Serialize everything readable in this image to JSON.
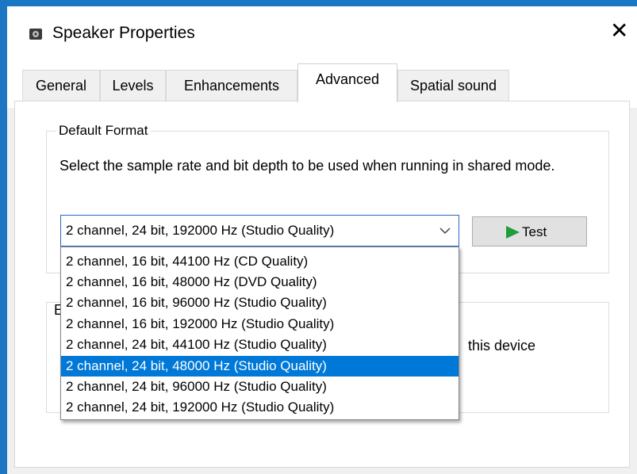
{
  "window": {
    "title": "Speaker Properties",
    "close_glyph": "✕"
  },
  "tabs": [
    {
      "label": "General"
    },
    {
      "label": "Levels"
    },
    {
      "label": "Enhancements"
    },
    {
      "label": "Advanced"
    },
    {
      "label": "Spatial sound"
    }
  ],
  "default_format": {
    "group_label": "Default Format",
    "description": "Select the sample rate and bit depth to be used when running in shared mode.",
    "selected_value": "2 channel, 24 bit, 192000 Hz (Studio Quality)",
    "test_label": "Test",
    "options": [
      "2 channel, 16 bit, 44100 Hz (CD Quality)",
      "2 channel, 16 bit, 48000 Hz (DVD Quality)",
      "2 channel, 16 bit, 96000 Hz (Studio Quality)",
      "2 channel, 16 bit, 192000 Hz (Studio Quality)",
      "2 channel, 24 bit, 44100 Hz (Studio Quality)",
      "2 channel, 24 bit, 48000 Hz (Studio Quality)",
      "2 channel, 24 bit, 96000 Hz (Studio Quality)",
      "2 channel, 24 bit, 192000 Hz (Studio Quality)"
    ],
    "highlighted_option": "2 channel, 24 bit, 48000 Hz (Studio Quality)"
  },
  "exclusive_mode": {
    "group_label_partial": "E",
    "partial_text": "this device"
  },
  "colors": {
    "accent": "#0078d7",
    "title_border": "#1b76c4",
    "play_green": "#1e9e3a"
  }
}
